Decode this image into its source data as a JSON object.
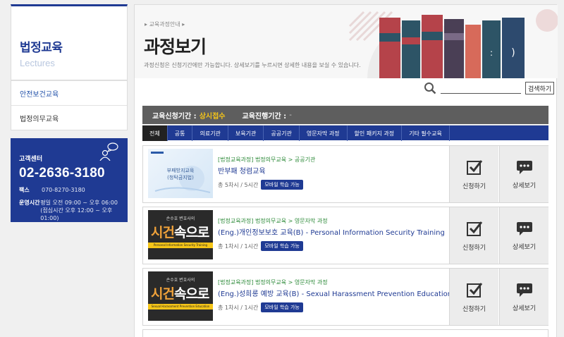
{
  "sidebar": {
    "title": "법정교육",
    "subtitle": "Lectures",
    "menu": [
      {
        "label": "안전보건교육"
      },
      {
        "label": "법정의무교육"
      }
    ],
    "customer_center": {
      "label": "고객센터",
      "phone": "02-2636-3180",
      "fax_label": "팩스",
      "fax": "070-8270-3180",
      "hours_label": "운영시간",
      "hours_line1": "평일 오전 09:00 ~ 오후 06:00",
      "hours_line2": "(점심시간 오후 12:00 ~ 오후 01:00)"
    }
  },
  "header": {
    "breadcrumb": "교육과정안내",
    "title": "과정보기",
    "description": "과정신청은 신청기간에만 가능합니다. 상세보기를 누르시면 상세한 내용을 보실 수 있습니다."
  },
  "search": {
    "placeholder": "",
    "button_label": "검색하기"
  },
  "period": {
    "apply_label": "교육신청기간 :",
    "apply_value": "상시접수",
    "run_label": "교육진행기간 :",
    "run_value": "-"
  },
  "tabs": [
    {
      "label": "전체"
    },
    {
      "label": "공통"
    },
    {
      "label": "의료기관"
    },
    {
      "label": "보육기관"
    },
    {
      "label": "공공기관"
    },
    {
      "label": "영문자막 과정"
    },
    {
      "label": "할인 패키지 과정"
    },
    {
      "label": "기타 필수교육"
    }
  ],
  "courses": [
    {
      "category": "[법정교육과정] 법정의무교육 > 공공기관",
      "title": "반부패 청렴교육",
      "meta": "총 5차시 / 5시간",
      "badge": "모바일 학습 가능",
      "thumb_text_1": "부패방지교육",
      "thumb_text_2": "(청탁금지법)",
      "apply_label": "신청하기",
      "detail_label": "상세보기"
    },
    {
      "category": "[법정교육과정] 법정의무교육 > 영문자막 과정",
      "title": "(Eng.)개인정보보호 교육(B) - Personal Information Security Training",
      "meta": "총 1차시 / 1시간",
      "badge": "모바일 학습 가능",
      "thumb_small": "손수호 변호사의",
      "thumb_big_1": "시건",
      "thumb_big_2": "속으로",
      "thumb_strip": "Personal Information Security Training",
      "apply_label": "신청하기",
      "detail_label": "상세보기"
    },
    {
      "category": "[법정교육과정] 법정의무교육 > 영문자막 과정",
      "title": "(Eng.)성희롱 예방 교육(B) - Sexual Harassment Prevention Education",
      "meta": "총 1차시 / 1시간",
      "badge": "모바일 학습 가능",
      "thumb_small": "손수호 변호사의",
      "thumb_big_1": "시건",
      "thumb_big_2": "속으로",
      "thumb_strip": "Sexual Harassment Prevention Education",
      "apply_label": "신청하기",
      "detail_label": "상세보기"
    }
  ],
  "colors": {
    "brand_blue": "#1f3a93",
    "highlight_yellow": "#f5c518",
    "category_green": "#2e8b3a"
  }
}
